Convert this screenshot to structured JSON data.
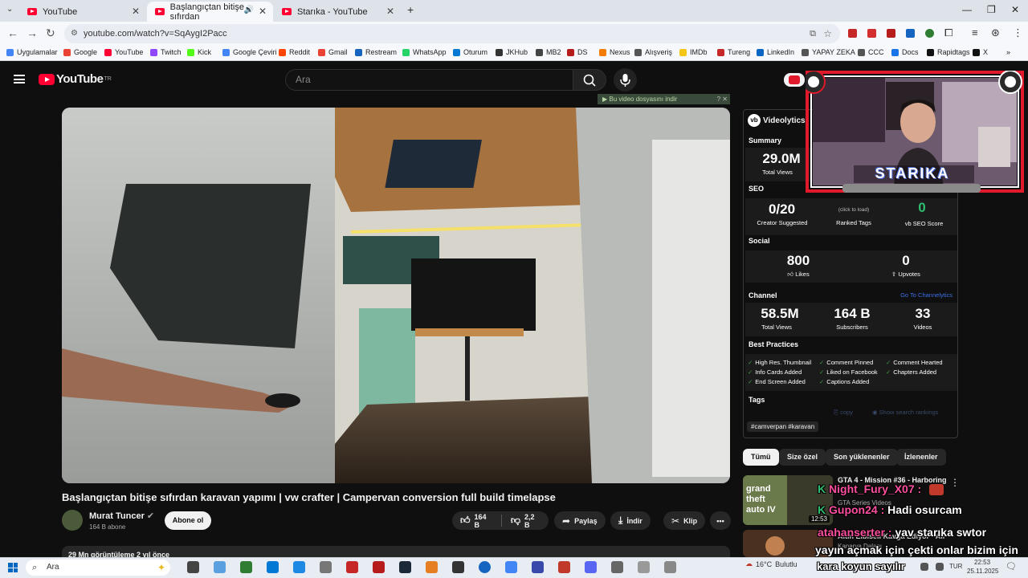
{
  "browser": {
    "tabs": [
      {
        "label": "YouTube"
      },
      {
        "label": "Başlangıçtan bitişe sıfırdan"
      },
      {
        "label": "Starıka - YouTube"
      }
    ],
    "url": "youtube.com/watch?v=SqAygI2Pacc",
    "bookmarks": [
      "Uygulamalar",
      "Google",
      "YouTube",
      "Twitch",
      "Kick",
      "Google Çeviri",
      "Reddit",
      "Gmail",
      "Restream",
      "WhatsApp",
      "Oturum",
      "JKHub",
      "MB2",
      "DS",
      "Nexus",
      "Alışveriş",
      "IMDb",
      "Tureng",
      "LinkedIn",
      "YAPAY ZEKA",
      "CCC",
      "Docs",
      "Rapidtags",
      "X"
    ]
  },
  "header": {
    "logo": "YouTube",
    "logo_sup": "TR",
    "search_placeholder": "Ara"
  },
  "download_banner": "Bu video dosyasını indir",
  "video": {
    "title": "Başlangıçtan bitişe sıfırdan karavan yapımı | vw crafter | Campervan conversion full build timelapse",
    "channel": "Murat Tuncer",
    "subscribers": "164 B abone",
    "subscribe_label": "Abone ol",
    "likes": "164 B",
    "dislikes": "2,2 B",
    "share_label": "Paylaş",
    "download_label": "İndir",
    "clip_label": "Klip",
    "description_peek": "29 Mn görüntüleme  2 yıl önce"
  },
  "videolytics": {
    "brand": "Videolytics",
    "summary_title": "Summary",
    "total_views": "29.0M",
    "total_views_label": "Total Views",
    "seo_title": "SEO",
    "creator_suggested": "0/20",
    "creator_suggested_label": "Creator Suggested",
    "ranked_tags_hint": "(click to load)",
    "ranked_tags_label": "Ranked Tags",
    "seo_score": "0",
    "seo_score_label": "SEO Score",
    "social_title": "Social",
    "likes": "800",
    "likes_label": "Likes",
    "upvotes": "0",
    "upvotes_label": "Upvotes",
    "channel_title": "Channel",
    "channel_link": "Go To Channelytics",
    "ch_views": "58.5M",
    "ch_views_label": "Total Views",
    "ch_subs": "164 B",
    "ch_subs_label": "Subscribers",
    "ch_videos": "33",
    "ch_videos_label": "Videos",
    "bp_title": "Best Practices",
    "best_practices": [
      "High Res. Thumbnail",
      "Comment Pinned",
      "Comment Hearted",
      "Info Cards Added",
      "Liked on Facebook",
      "Chapters Added",
      "End Screen Added",
      "Captions Added"
    ],
    "tags_title": "Tags",
    "copy_label": "copy",
    "show_rankings_label": "Show search rankings",
    "tags": "#camverpan #karavan"
  },
  "chips": [
    "Tümü",
    "Size özel",
    "Son yüklenenler",
    "İzlenenler"
  ],
  "recommended": [
    {
      "title": "GTA 4 - Mission #36 - Harboring",
      "channel": "GTA Series Videos",
      "duration": "12:53"
    },
    {
      "title": "Altın Elbiseli Kavga Ediyor - Ali",
      "channel": "Kanarya Dalanı"
    }
  ],
  "overlay": {
    "streamer_name": "STARIKA",
    "chat": [
      {
        "user": "Night_Fury_X07 :",
        "msg": ""
      },
      {
        "user": "Gupon24 :",
        "msg": "Hadi osurcam"
      },
      {
        "user": "atahanserter :",
        "msg": "yav starıka swtor"
      },
      {
        "user": "",
        "msg": "yayın açmak için çekti onlar bizim için"
      },
      {
        "user": "",
        "msg": "kara koyun sayılır"
      }
    ]
  },
  "taskbar": {
    "search": "Ara",
    "weather_temp": "16°C",
    "weather_text": "Bulutlu",
    "lang": "TUR",
    "time": "22:53",
    "date": "25.11.2025"
  },
  "colors": {
    "yt_red": "#ff0033",
    "bg": "#0f0f0f",
    "overlay_frame": "#e01a2b",
    "seo_green": "#2fbf71",
    "chat_pink": "#ff4fa0"
  }
}
